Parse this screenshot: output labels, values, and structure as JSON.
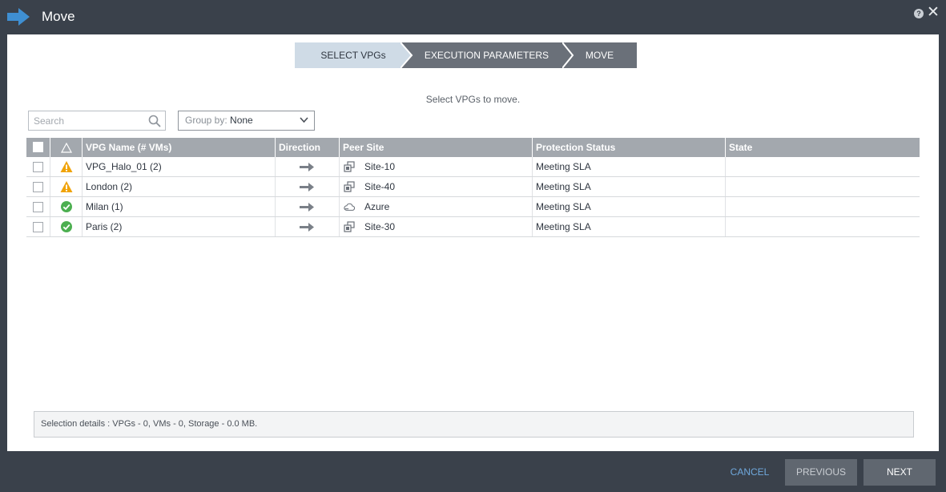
{
  "window": {
    "title": "Move",
    "help_icon": "question-icon",
    "close_label": "✕"
  },
  "wizard": {
    "steps": [
      {
        "label": "SELECT VPGs",
        "state": "active"
      },
      {
        "label": "EXECUTION PARAMETERS",
        "state": "inactive"
      },
      {
        "label": "MOVE",
        "state": "inactive"
      }
    ],
    "colors": {
      "active": "#cfdbe6",
      "inactive": "#6a7079"
    }
  },
  "instructions": "Select VPGs to move.",
  "search": {
    "placeholder": "Search",
    "value": ""
  },
  "groupby": {
    "label": "Group by: ",
    "value": "None"
  },
  "table": {
    "columns": [
      "VPG Name (# VMs)",
      "Direction",
      "Peer Site",
      "Protection Status",
      "State"
    ],
    "rows": [
      {
        "status": "warning",
        "name": "VPG_Halo_01 (2)",
        "direction": "arrow-right-icon",
        "site_type": "vsphere",
        "peer_site": "Site-10",
        "protection": "Meeting SLA",
        "state": ""
      },
      {
        "status": "warning",
        "name": "London (2)",
        "direction": "arrow-right-icon",
        "site_type": "vsphere",
        "peer_site": "Site-40",
        "protection": "Meeting SLA",
        "state": ""
      },
      {
        "status": "ok",
        "name": "Milan (1)",
        "direction": "arrow-right-icon",
        "site_type": "cloud",
        "peer_site": "Azure",
        "protection": "Meeting SLA",
        "state": ""
      },
      {
        "status": "ok",
        "name": "Paris (2)",
        "direction": "arrow-right-icon",
        "site_type": "vsphere",
        "peer_site": "Site-30",
        "protection": "Meeting SLA",
        "state": ""
      }
    ]
  },
  "selection_details": "Selection details :  VPGs  -  0, VMs  -  0, Storage  -  0.0 MB.",
  "footer": {
    "cancel": "CANCEL",
    "previous": "PREVIOUS",
    "next": "NEXT"
  },
  "colors": {
    "warning": "#f0a30a",
    "ok": "#4caf50",
    "brand_arrow": "#3f8fd2"
  }
}
